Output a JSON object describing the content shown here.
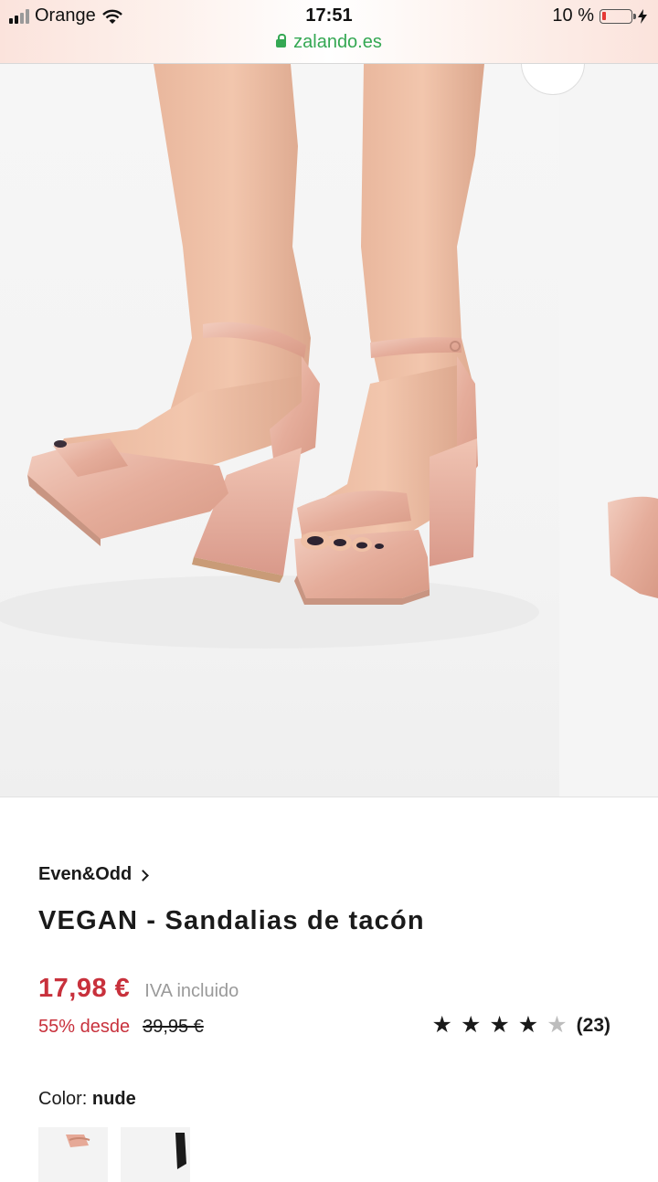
{
  "status_bar": {
    "carrier": "Orange",
    "time": "17:51",
    "url": "zalando.es",
    "battery": "10 %"
  },
  "product": {
    "brand": "Even&Odd",
    "title": "VEGAN - Sandalias de tacón",
    "price": "17,98 €",
    "vat": "IVA incluido",
    "discount": "55% desde",
    "original_price": "39,95 €",
    "rating": {
      "stars": 4,
      "max": 5,
      "count": "(23)"
    },
    "color_label": "Color:",
    "color_value": "nude"
  },
  "colors": {
    "price_red": "#c8313c",
    "url_green": "#34a853",
    "satin_pink": "#e8b3a3"
  }
}
